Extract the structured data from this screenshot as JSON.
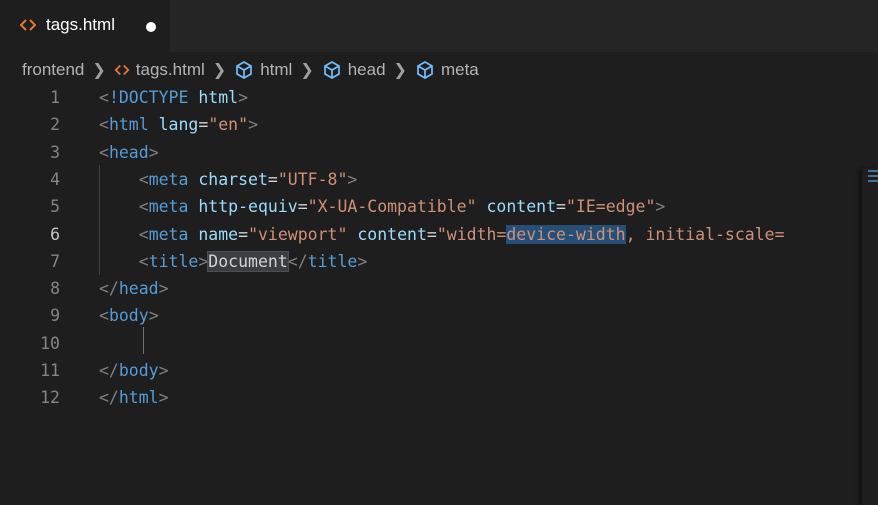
{
  "tab": {
    "filename": "tags.html"
  },
  "breadcrumb": {
    "folder": "frontend",
    "file": "tags.html",
    "symbols": [
      "html",
      "head",
      "meta"
    ]
  },
  "editor": {
    "active_line": 6,
    "lines": [
      {
        "number": "1",
        "parts": [
          [
            "punct",
            "<"
          ],
          [
            "tag",
            "!DOCTYPE"
          ],
          [
            "txt",
            " "
          ],
          [
            "attr",
            "html"
          ],
          [
            "punct",
            ">"
          ]
        ]
      },
      {
        "number": "2",
        "parts": [
          [
            "punct",
            "<"
          ],
          [
            "tag",
            "html"
          ],
          [
            "txt",
            " "
          ],
          [
            "attr",
            "lang"
          ],
          [
            "txt",
            "="
          ],
          [
            "str",
            "\"en\""
          ],
          [
            "punct",
            ">"
          ]
        ]
      },
      {
        "number": "3",
        "parts": [
          [
            "punct",
            "<"
          ],
          [
            "tag",
            "head"
          ],
          [
            "punct",
            ">"
          ]
        ]
      },
      {
        "number": "4",
        "parts": [
          [
            "txt",
            "    "
          ],
          [
            "punct",
            "<"
          ],
          [
            "tag",
            "meta"
          ],
          [
            "txt",
            " "
          ],
          [
            "attr",
            "charset"
          ],
          [
            "txt",
            "="
          ],
          [
            "str",
            "\"UTF-8\""
          ],
          [
            "punct",
            ">"
          ]
        ]
      },
      {
        "number": "5",
        "parts": [
          [
            "txt",
            "    "
          ],
          [
            "punct",
            "<"
          ],
          [
            "tag",
            "meta"
          ],
          [
            "txt",
            " "
          ],
          [
            "attr",
            "http-equiv"
          ],
          [
            "txt",
            "="
          ],
          [
            "str",
            "\"X-UA-Compatible\""
          ],
          [
            "txt",
            " "
          ],
          [
            "attr",
            "content"
          ],
          [
            "txt",
            "="
          ],
          [
            "str",
            "\"IE=edge\""
          ],
          [
            "punct",
            ">"
          ]
        ]
      },
      {
        "number": "6",
        "parts": [
          [
            "txt",
            "    "
          ],
          [
            "punct",
            "<"
          ],
          [
            "tag",
            "meta"
          ],
          [
            "txt",
            " "
          ],
          [
            "attr",
            "name"
          ],
          [
            "txt",
            "="
          ],
          [
            "str",
            "\"viewport\""
          ],
          [
            "txt",
            " "
          ],
          [
            "attr",
            "content"
          ],
          [
            "txt",
            "="
          ],
          [
            "str",
            "\"width="
          ],
          [
            "strsel",
            "device-width"
          ],
          [
            "str",
            ", initial-scale="
          ]
        ]
      },
      {
        "number": "7",
        "parts": [
          [
            "txt",
            "    "
          ],
          [
            "punct",
            "<"
          ],
          [
            "tag",
            "title"
          ],
          [
            "punct",
            ">"
          ],
          [
            "txtword",
            "Document"
          ],
          [
            "punct",
            "</"
          ],
          [
            "tag",
            "title"
          ],
          [
            "punct",
            ">"
          ]
        ]
      },
      {
        "number": "8",
        "parts": [
          [
            "punct",
            "</"
          ],
          [
            "tag",
            "head"
          ],
          [
            "punct",
            ">"
          ]
        ]
      },
      {
        "number": "9",
        "parts": [
          [
            "punct",
            "<"
          ],
          [
            "tag",
            "body"
          ],
          [
            "punct",
            ">"
          ]
        ]
      },
      {
        "number": "10",
        "parts": []
      },
      {
        "number": "11",
        "parts": [
          [
            "punct",
            "</"
          ],
          [
            "tag",
            "body"
          ],
          [
            "punct",
            ">"
          ]
        ]
      },
      {
        "number": "12",
        "parts": [
          [
            "punct",
            "</"
          ],
          [
            "tag",
            "html"
          ],
          [
            "punct",
            ">"
          ]
        ]
      }
    ]
  }
}
